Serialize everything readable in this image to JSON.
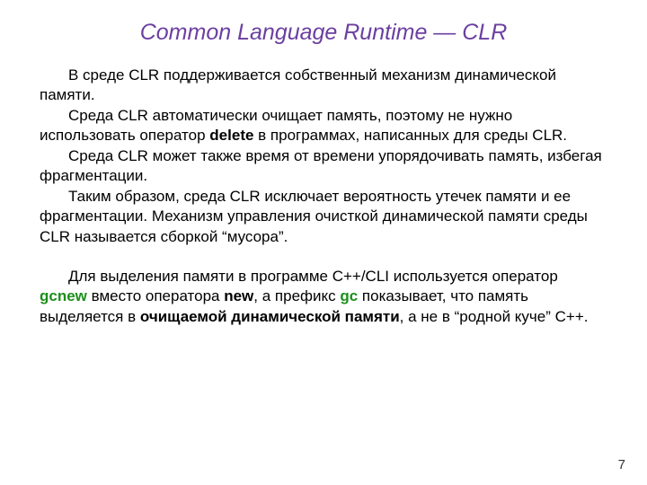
{
  "title": "Common Language Runtime — CLR",
  "p1a": "В среде CLR поддерживается собственный механизм динамической памяти.",
  "p2a": "Среда CLR автоматически очищает память, поэтому не нужно использовать оператор ",
  "p2_delete": "delete",
  "p2b": " в программах, написанных для среды CLR.",
  "p3": "Среда CLR может также время от времени упорядочивать память, избегая фрагментации.",
  "p4": "Таким образом, среда CLR исключает вероятность утечек памяти и ее фрагментации. Механизм управления очисткой динамической памяти среды CLR называется сборкой “мусора”.",
  "p5a": "Для выделения памяти в программе С++/CLI используется оператор ",
  "p5_gcnew": "gcnew",
  "p5b": " вместо оператора ",
  "p5_new": "new",
  "p5c": ", а префикс ",
  "p5_gc": "gc",
  "p5d": " показывает, что память выделяется в ",
  "p5_cleanheap": "очищаемой динамической памяти",
  "p5e": ", а не в “родной куче” С++.",
  "page": "7"
}
